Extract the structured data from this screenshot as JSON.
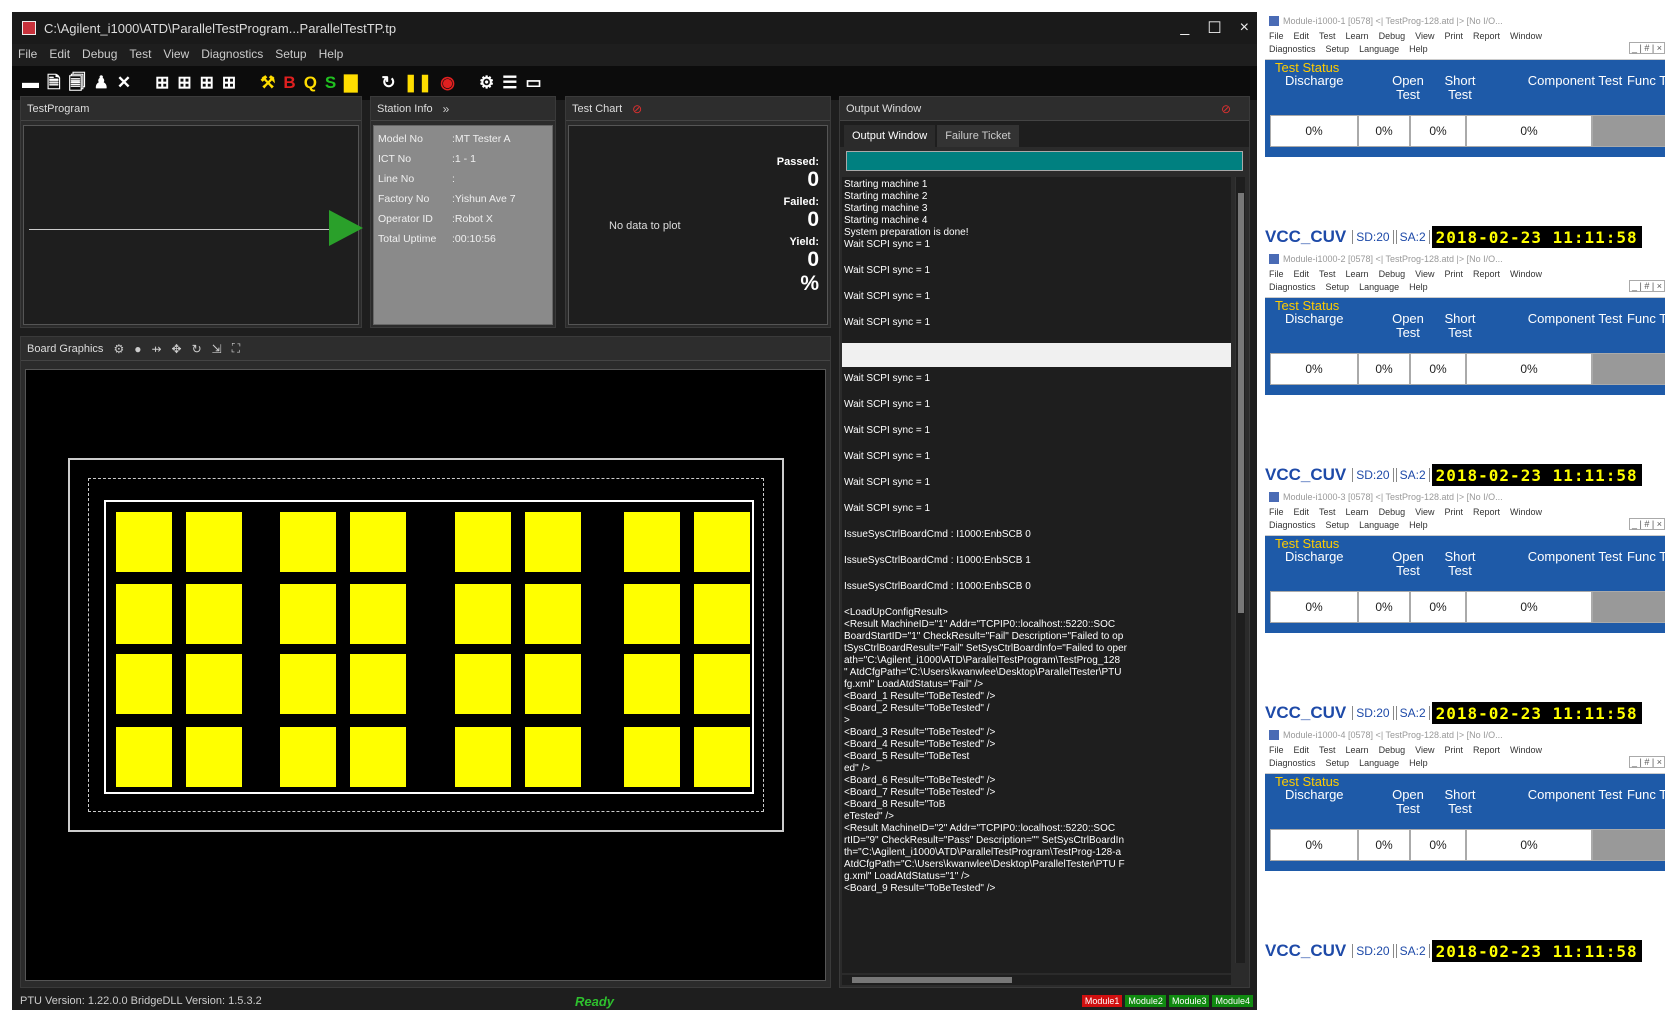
{
  "window": {
    "title": "C:\\Agilent_i1000\\ATD\\ParallelTestProgram...ParallelTestTP.tp",
    "controls": [
      "_",
      "☐",
      "×"
    ]
  },
  "menu": [
    "File",
    "Edit",
    "Debug",
    "Test",
    "View",
    "Diagnostics",
    "Setup",
    "Help"
  ],
  "toolbar": {
    "icons": [
      "new-icon",
      "save-icon",
      "save-as-icon",
      "user-icon",
      "close-icon",
      "grid-icon",
      "grid2-icon",
      "grid3-icon",
      "grid4-icon",
      "debug-icon",
      "bi-icon",
      "qi-icon",
      "si-icon",
      "chart-icon",
      "refresh-icon",
      "pause-icon",
      "stop-icon",
      "settings-icon",
      "list-icon",
      "display-icon"
    ],
    "colors": {
      "accent_yellow": "#ffdd00",
      "red": "#e02020",
      "green": "#20c020"
    }
  },
  "test_program": {
    "title": "TestProgram"
  },
  "station_info": {
    "title": "Station Info",
    "rows": [
      {
        "key": "Model No",
        "value": ":MT Tester A"
      },
      {
        "key": "ICT No",
        "value": ":1 - 1"
      },
      {
        "key": "Line No",
        "value": ":"
      },
      {
        "key": "Factory No",
        "value": ":Yishun Ave 7"
      },
      {
        "key": "Operator ID",
        "value": ":Robot X"
      },
      {
        "key": "Total Uptime",
        "value": ":00:10:56"
      }
    ]
  },
  "test_chart": {
    "title": "Test Chart",
    "no_data": "No data to plot",
    "passed_label": "Passed:",
    "passed_value": "0",
    "failed_label": "Failed:",
    "failed_value": "0",
    "yield_label": "Yield:",
    "yield_value": "0",
    "yield_unit": "%"
  },
  "board_graphics": {
    "title": "Board Graphics",
    "pad_color": "#ffff00"
  },
  "output_window": {
    "title": "Output Window",
    "tabs": [
      "Output Window",
      "Failure Ticket"
    ],
    "log": [
      "Starting machine 1",
      "Starting machine 2",
      "Starting machine 3",
      "Starting machine 4",
      "System preparation is done!",
      "Wait SCPI sync = 1",
      "Wait SCPI sync = 1",
      "Wait SCPI sync = 1",
      "Wait SCPI sync = 1",
      "Wait SCPI sync = 1",
      "Wait SCPI sync = 1",
      "Wait SCPI sync = 1",
      "Wait SCPI sync = 1",
      "Wait SCPI sync = 1",
      "Wait SCPI sync = 1",
      "IssueSysCtrlBoardCmd : I1000:EnbSCB 0",
      "IssueSysCtrlBoardCmd : I1000:EnbSCB 1",
      "IssueSysCtrlBoardCmd : I1000:EnbSCB 0",
      "<LoadUpConfigResult>",
      "  <Result MachineID=\"1\" Addr=\"TCPIP0::localhost::5220::SOC",
      " BoardStartID=\"1\" CheckResult=\"Fail\" Description=\"Failed to op",
      "tSysCtrlBoardResult=\"Fail\" SetSysCtrlBoardInfo=\"Failed to oper",
      "ath=\"C:\\Agilent_i1000\\ATD\\ParallelTestProgram\\TestProg_128",
      "\" AtdCfgPath=\"C:\\Users\\kwanwlee\\Desktop\\ParallelTester\\PTU",
      "fg.xml\" LoadAtdStatus=\"Fail\" />",
      "  <Board_1 Result=\"ToBeTested\" />",
      "  <Board_2 Result=\"ToBeTested\" /",
      ">",
      "  <Board_3 Result=\"ToBeTested\" />",
      "  <Board_4 Result=\"ToBeTested\" />",
      "  <Board_5 Result=\"ToBeTest",
      "ed\" />",
      "  <Board_6 Result=\"ToBeTested\" />",
      "  <Board_7 Result=\"ToBeTested\" />",
      "  <Board_8 Result=\"ToB",
      "eTested\" />",
      "  <Result MachineID=\"2\" Addr=\"TCPIP0::localhost::5220::SOC",
      "rtID=\"9\" CheckResult=\"Pass\" Description=\"\" SetSysCtrlBoardIn",
      "th=\"C:\\Agilent_i1000\\ATD\\ParallelTestProgram\\TestProg-128-a",
      " AtdCfgPath=\"C:\\Users\\kwanwlee\\Desktop\\ParallelTester\\PTU F",
      "g.xml\" LoadAtdStatus=\"1\" />",
      "  <Board_9 Result=\"ToBeTested\" />"
    ],
    "selected_line": "Wait SCPI sync = 1",
    "progress_color": "#008080"
  },
  "status_bar": {
    "version": "PTU Version: 1.22.0.0  BridgeDLL Version: 1.5.3.2",
    "ready": "Ready",
    "modules": [
      {
        "label": "Module1",
        "color": "#d01010"
      },
      {
        "label": "Module2",
        "color": "#108a10"
      },
      {
        "label": "Module3",
        "color": "#108a10"
      },
      {
        "label": "Module4",
        "color": "#108a10"
      }
    ]
  },
  "module_windows": [
    {
      "title": "Module-i1000-1 [0578] <| TestProg-128.atd |> [No I/O...",
      "menu1": [
        "File",
        "Edit",
        "Test",
        "Learn",
        "Debug",
        "View",
        "Print",
        "Report",
        "Window"
      ],
      "menu2": [
        "Diagnostics",
        "Setup",
        "Language",
        "Help"
      ],
      "buttons": "_ | # | ×",
      "status_title": "Test Status",
      "headers": [
        "Discharge",
        "Open Test",
        "Short Test",
        "Component Test",
        "Func Test"
      ],
      "values": [
        "0%",
        "0%",
        "0%",
        "0%",
        ""
      ],
      "vcc": "VCC_CUV",
      "sd": "SD:20",
      "sa": "SA:2",
      "datetime": "2018-02-23 11:11:58"
    },
    {
      "title": "Module-i1000-2 [0578] <| TestProg-128.atd |> [No I/O...",
      "menu1": [
        "File",
        "Edit",
        "Test",
        "Learn",
        "Debug",
        "View",
        "Print",
        "Report",
        "Window"
      ],
      "menu2": [
        "Diagnostics",
        "Setup",
        "Language",
        "Help"
      ],
      "buttons": "_ | # | ×",
      "status_title": "Test Status",
      "headers": [
        "Discharge",
        "Open Test",
        "Short Test",
        "Component Test",
        "Func Test"
      ],
      "values": [
        "0%",
        "0%",
        "0%",
        "0%",
        ""
      ],
      "vcc": "VCC_CUV",
      "sd": "SD:20",
      "sa": "SA:2",
      "datetime": "2018-02-23 11:11:58"
    },
    {
      "title": "Module-i1000-3 [0578] <| TestProg-128.atd |> [No I/O...",
      "menu1": [
        "File",
        "Edit",
        "Test",
        "Learn",
        "Debug",
        "View",
        "Print",
        "Report",
        "Window"
      ],
      "menu2": [
        "Diagnostics",
        "Setup",
        "Language",
        "Help"
      ],
      "buttons": "_ | # | ×",
      "status_title": "Test Status",
      "headers": [
        "Discharge",
        "Open Test",
        "Short Test",
        "Component Test",
        "Func Test"
      ],
      "values": [
        "0%",
        "0%",
        "0%",
        "0%",
        ""
      ],
      "vcc": "VCC_CUV",
      "sd": "SD:20",
      "sa": "SA:2",
      "datetime": "2018-02-23 11:11:58"
    },
    {
      "title": "Module-i1000-4 [0578] <| TestProg-128.atd |> [No I/O...",
      "menu1": [
        "File",
        "Edit",
        "Test",
        "Learn",
        "Debug",
        "View",
        "Print",
        "Report",
        "Window"
      ],
      "menu2": [
        "Diagnostics",
        "Setup",
        "Language",
        "Help"
      ],
      "buttons": "_ | # | ×",
      "status_title": "Test Status",
      "headers": [
        "Discharge",
        "Open Test",
        "Short Test",
        "Component Test",
        "Func Test"
      ],
      "values": [
        "0%",
        "0%",
        "0%",
        "0%",
        ""
      ],
      "vcc": "VCC_CUV",
      "sd": "SD:20",
      "sa": "SA:2",
      "datetime": "2018-02-23 11:11:58"
    }
  ]
}
